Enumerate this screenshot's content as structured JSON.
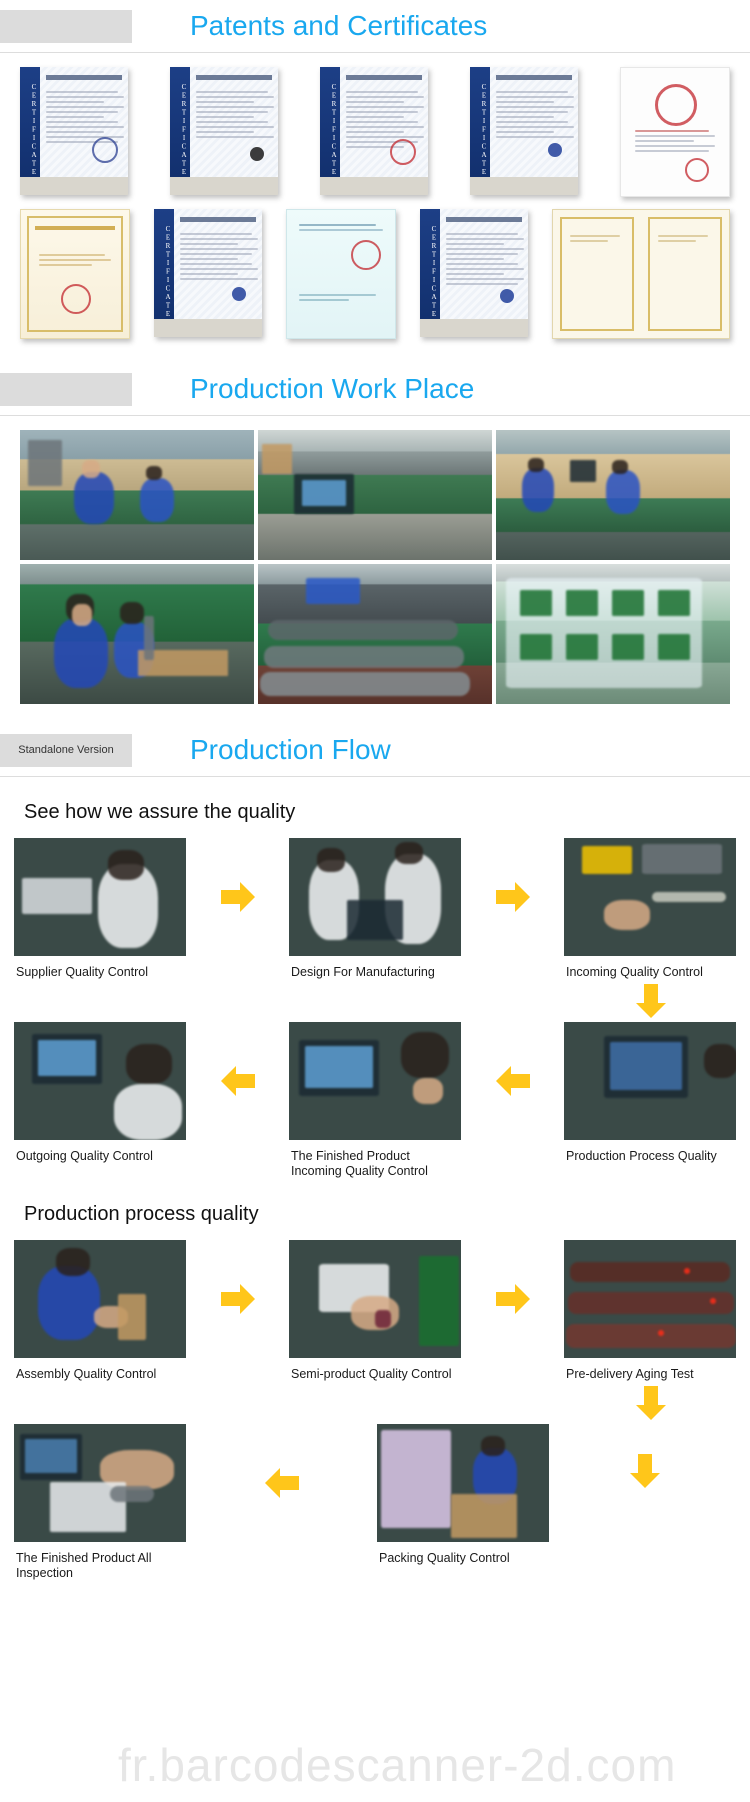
{
  "sections": {
    "certificates": {
      "badge": "",
      "title": "Patents and Certificates",
      "row1": [
        {
          "name": "certificate-verification-1",
          "style": "blue",
          "spine": "CERTIFICATE"
        },
        {
          "name": "certificate-verification-2",
          "style": "blue",
          "spine": "CERTIFICATE"
        },
        {
          "name": "certificate-verification-3",
          "style": "blue",
          "spine": "CERTIFICATE"
        },
        {
          "name": "certificate-verification-4",
          "style": "blue",
          "spine": "CERTIFICATE"
        },
        {
          "name": "certificate-red-seal-award",
          "style": "white",
          "spine": ""
        }
      ],
      "row2": [
        {
          "name": "certificate-guangdong-gold",
          "style": "gold",
          "spine": ""
        },
        {
          "name": "certificate-verification-5",
          "style": "blue",
          "spine": "CERTIFICATE"
        },
        {
          "name": "certificate-business-license",
          "style": "cyan",
          "spine": ""
        },
        {
          "name": "certificate-verification-6",
          "style": "blue",
          "spine": "CERTIFICATE"
        },
        {
          "name": "certificate-double-page-book",
          "style": "book",
          "spine": ""
        }
      ]
    },
    "workplace": {
      "badge": "",
      "title": "Production Work Place",
      "row1": [
        {
          "name": "photo-machining-shop",
          "style": "ph-bench"
        },
        {
          "name": "photo-smt-equipment",
          "style": "ph-line"
        },
        {
          "name": "photo-assembly-line-desks",
          "style": "ph-bench2"
        }
      ],
      "row2": [
        {
          "name": "photo-workers-screwdriver",
          "style": "ph-green"
        },
        {
          "name": "photo-scanner-array",
          "style": "ph-scanners"
        },
        {
          "name": "photo-pcb-trays",
          "style": "ph-trays"
        }
      ]
    },
    "flow": {
      "badge": "Standalone Version",
      "title": "Production Flow",
      "heading1": "See how we assure the quality",
      "heading2": "Production process quality",
      "group1": {
        "row1": [
          {
            "name": "flow-supplier-quality-control",
            "label": "Supplier Quality Control",
            "style": "ph-bench2"
          },
          {
            "name": "flow-design-for-manufacturing",
            "label": "Design For Manufacturing",
            "style": "ph-line"
          },
          {
            "name": "flow-incoming-quality-control",
            "label": "Incoming Quality Control",
            "style": "ph-green"
          }
        ],
        "row2": [
          {
            "name": "flow-outgoing-quality-control",
            "label": "Outgoing  Quality Control",
            "style": "ph-bench"
          },
          {
            "name": "flow-finished-product-incoming-quality-control",
            "label": "The Finished Product Incoming Quality Control",
            "style": "ph-line"
          },
          {
            "name": "flow-production-process-quality",
            "label": "Production Process Quality",
            "style": "ph-trays"
          }
        ]
      },
      "group2": {
        "row1": [
          {
            "name": "flow-assembly-quality-control",
            "label": "Assembly Quality Control",
            "style": "ph-green"
          },
          {
            "name": "flow-semi-product-quality-control",
            "label": "Semi-product Quality Control",
            "style": "ph-bench2"
          },
          {
            "name": "flow-pre-delivery-aging-test",
            "label": "Pre-delivery Aging Test",
            "style": "ph-scanners"
          }
        ],
        "row2": [
          {
            "name": "flow-finished-product-all-inspection",
            "label": "The Finished Product All Inspection",
            "style": "ph-green"
          },
          {
            "name": "flow-packing-quality-control",
            "label": "Packing Quality Control",
            "style": "ph-bench"
          }
        ]
      }
    }
  },
  "watermark": "fr.barcodescanner-2d.com",
  "colors": {
    "title_blue": "#19a8ef",
    "arrow_yellow": "#ffc61a",
    "badge_grey": "#dcdcdc",
    "watermark_grey": "#e6e6e6"
  }
}
